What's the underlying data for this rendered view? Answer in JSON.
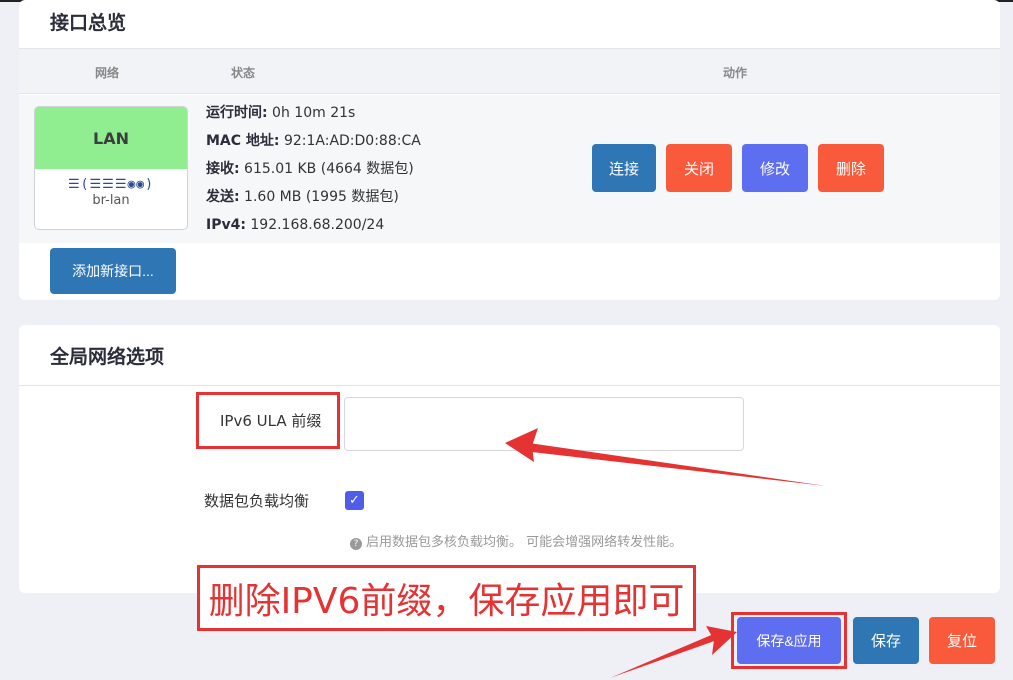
{
  "interfaces_card": {
    "title": "接口总览",
    "headers": {
      "network": "网络",
      "status": "状态",
      "actions": "动作"
    },
    "row": {
      "name": "LAN",
      "icons": "☰(☰☰☰◉◉)",
      "device": "br-lan",
      "status": [
        {
          "label": "运行时间:",
          "value": " 0h 10m 21s"
        },
        {
          "label": "MAC 地址:",
          "value": " 92:1A:AD:D0:88:CA"
        },
        {
          "label": "接收:",
          "value": " 615.01 KB (4664 数据包)"
        },
        {
          "label": "发送:",
          "value": " 1.60 MB (1995 数据包)"
        },
        {
          "label": "IPv4:",
          "value": " 192.168.68.200/24"
        }
      ],
      "buttons": {
        "connect": "连接",
        "close": "关闭",
        "edit": "修改",
        "delete": "删除"
      }
    },
    "add_button": "添加新接口..."
  },
  "global_card": {
    "title": "全局网络选项",
    "ula_label": "IPv6 ULA 前缀",
    "ula_value": "",
    "packet_steering_label": "数据包负载均衡",
    "packet_steering_checked": true,
    "help_text": "启用数据包多核负载均衡。 可能会增强网络转发性能。"
  },
  "annotation": {
    "text": "删除IPV6前缀，保存应用即可",
    "color": "#e53232"
  },
  "footer": {
    "save_apply": "保存&应用",
    "save": "保存",
    "reset": "复位"
  },
  "colors": {
    "blue": "#2f76b5",
    "red": "#fa5a3c",
    "purple": "#5e6ef0",
    "lan_green": "#90ee90"
  }
}
